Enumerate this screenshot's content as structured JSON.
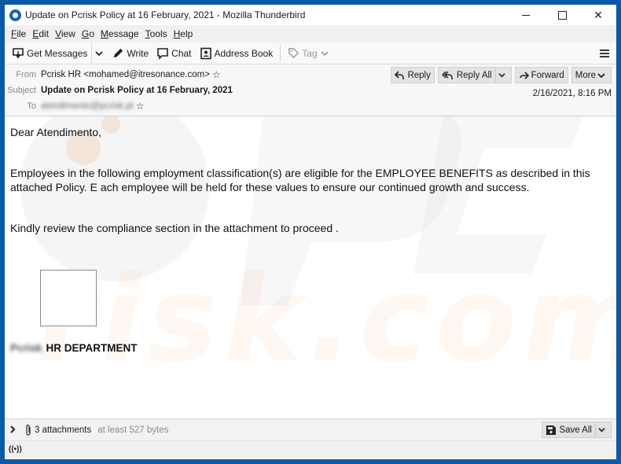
{
  "window": {
    "title": "Update on Pcrisk Policy at 16 February, 2021 - Mozilla Thunderbird",
    "controls": {
      "minimize": "minimize",
      "maximize": "maximize",
      "close": "✕"
    }
  },
  "menubar": {
    "items": [
      {
        "accel": "F",
        "rest": "ile"
      },
      {
        "accel": "E",
        "rest": "dit"
      },
      {
        "accel": "V",
        "rest": "iew"
      },
      {
        "accel": "G",
        "rest": "o"
      },
      {
        "accel": "M",
        "rest": "essage"
      },
      {
        "accel": "T",
        "rest": "ools"
      },
      {
        "accel": "H",
        "rest": "elp"
      }
    ]
  },
  "toolbar": {
    "get_messages": "Get Messages",
    "write": "Write",
    "chat": "Chat",
    "address_book": "Address Book",
    "tag": "Tag"
  },
  "header": {
    "from_label": "From",
    "from_value": "Pcrisk HR <mohamed@itresonance.com>",
    "subject_label": "Subject",
    "subject_value": "Update on Pcrisk Policy at 16 February, 2021",
    "to_label": "To",
    "to_value": "atendimento@pcrisk.pt",
    "date": "2/16/2021, 8:16 PM",
    "actions": {
      "reply": "Reply",
      "reply_all": "Reply All",
      "forward": "Forward",
      "more": "More"
    }
  },
  "body": {
    "greeting": "Dear Atendimento,",
    "paragraph1_line1": "Employees in the following employment classification(s) are eligible for the EMPLOYEE BENEFITS as described in this",
    "paragraph1_line2": "attached Policy. E ach employee will be held for these values to ensure our continued growth and success.",
    "paragraph2": "Kindly review the compliance section in the attachment to proceed .",
    "signature_prefix": "Pcrisk",
    "signature": "HR DEPARTMENT",
    "watermark": "PC risk.com"
  },
  "attachments": {
    "count_label": "3 attachments",
    "size_label": "at least 527 bytes",
    "save_all": "Save All"
  },
  "colors": {
    "frame": "#0b5aa6",
    "watermark_orange": "#f5a06a",
    "watermark_gray": "#c8c8c8"
  }
}
